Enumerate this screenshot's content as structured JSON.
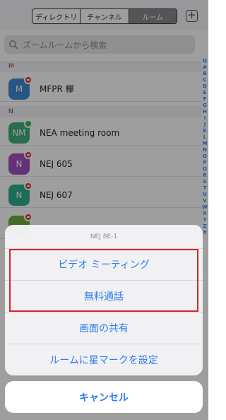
{
  "header": {
    "tabs": [
      {
        "label": "ディレクトリ"
      },
      {
        "label": "チャンネル"
      },
      {
        "label": "ルーム"
      }
    ],
    "add_icon": "plus-icon"
  },
  "search": {
    "placeholder": "ズームルームから検索",
    "icon": "search-icon"
  },
  "list": {
    "sections": [
      {
        "letter": "M"
      },
      {
        "letter": "N"
      }
    ],
    "rooms": [
      {
        "initials": "M",
        "name": "MFPR 欅",
        "status": "busy",
        "color": "#3d8bd6"
      },
      {
        "initials": "NM",
        "name": "NEA meeting room",
        "status": "online",
        "color": "#3fb27f"
      },
      {
        "initials": "N",
        "name": "NEJ 605",
        "status": "busy",
        "color": "#a34fc2"
      },
      {
        "initials": "N",
        "name": "NEJ 607",
        "status": "busy",
        "color": "#2eae8e"
      }
    ]
  },
  "index_letters": [
    "Q",
    "A",
    "B",
    "C",
    "D",
    "E",
    "F",
    "G",
    "H",
    "I",
    "J",
    "K",
    "L",
    "M",
    "N",
    "O",
    "P",
    "Q",
    "R",
    "S",
    "T",
    "U",
    "V",
    "W",
    "X",
    "Y",
    "Z",
    "#"
  ],
  "action_sheet": {
    "title": "NEJ 8E-1",
    "actions": [
      {
        "label": "ビデオ ミーティング"
      },
      {
        "label": "無料通話"
      },
      {
        "label": "画面の共有"
      },
      {
        "label": "ルームに星マークを設定"
      }
    ],
    "cancel_label": "キャンセル",
    "accent_color": "#2d7cf6",
    "highlight_color": "#d9232d"
  }
}
